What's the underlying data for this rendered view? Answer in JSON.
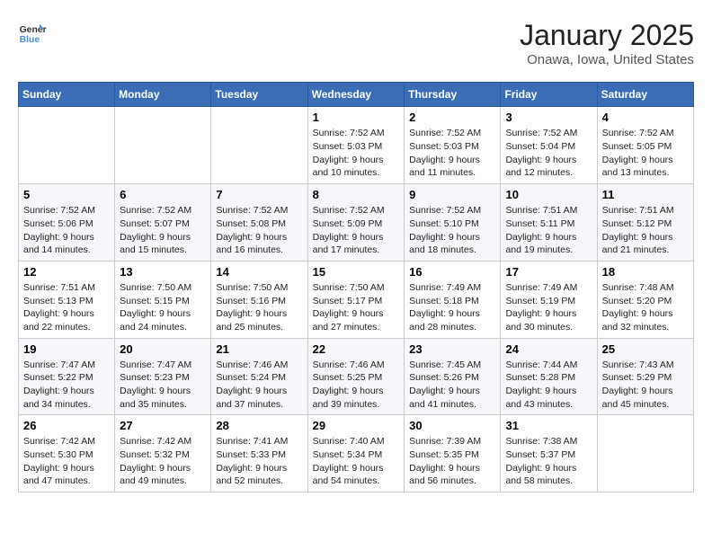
{
  "logo": {
    "line1": "General",
    "line2": "Blue"
  },
  "title": "January 2025",
  "location": "Onawa, Iowa, United States",
  "weekdays": [
    "Sunday",
    "Monday",
    "Tuesday",
    "Wednesday",
    "Thursday",
    "Friday",
    "Saturday"
  ],
  "weeks": [
    [
      {
        "day": "",
        "info": ""
      },
      {
        "day": "",
        "info": ""
      },
      {
        "day": "",
        "info": ""
      },
      {
        "day": "1",
        "info": "Sunrise: 7:52 AM\nSunset: 5:03 PM\nDaylight: 9 hours\nand 10 minutes."
      },
      {
        "day": "2",
        "info": "Sunrise: 7:52 AM\nSunset: 5:03 PM\nDaylight: 9 hours\nand 11 minutes."
      },
      {
        "day": "3",
        "info": "Sunrise: 7:52 AM\nSunset: 5:04 PM\nDaylight: 9 hours\nand 12 minutes."
      },
      {
        "day": "4",
        "info": "Sunrise: 7:52 AM\nSunset: 5:05 PM\nDaylight: 9 hours\nand 13 minutes."
      }
    ],
    [
      {
        "day": "5",
        "info": "Sunrise: 7:52 AM\nSunset: 5:06 PM\nDaylight: 9 hours\nand 14 minutes."
      },
      {
        "day": "6",
        "info": "Sunrise: 7:52 AM\nSunset: 5:07 PM\nDaylight: 9 hours\nand 15 minutes."
      },
      {
        "day": "7",
        "info": "Sunrise: 7:52 AM\nSunset: 5:08 PM\nDaylight: 9 hours\nand 16 minutes."
      },
      {
        "day": "8",
        "info": "Sunrise: 7:52 AM\nSunset: 5:09 PM\nDaylight: 9 hours\nand 17 minutes."
      },
      {
        "day": "9",
        "info": "Sunrise: 7:52 AM\nSunset: 5:10 PM\nDaylight: 9 hours\nand 18 minutes."
      },
      {
        "day": "10",
        "info": "Sunrise: 7:51 AM\nSunset: 5:11 PM\nDaylight: 9 hours\nand 19 minutes."
      },
      {
        "day": "11",
        "info": "Sunrise: 7:51 AM\nSunset: 5:12 PM\nDaylight: 9 hours\nand 21 minutes."
      }
    ],
    [
      {
        "day": "12",
        "info": "Sunrise: 7:51 AM\nSunset: 5:13 PM\nDaylight: 9 hours\nand 22 minutes."
      },
      {
        "day": "13",
        "info": "Sunrise: 7:50 AM\nSunset: 5:15 PM\nDaylight: 9 hours\nand 24 minutes."
      },
      {
        "day": "14",
        "info": "Sunrise: 7:50 AM\nSunset: 5:16 PM\nDaylight: 9 hours\nand 25 minutes."
      },
      {
        "day": "15",
        "info": "Sunrise: 7:50 AM\nSunset: 5:17 PM\nDaylight: 9 hours\nand 27 minutes."
      },
      {
        "day": "16",
        "info": "Sunrise: 7:49 AM\nSunset: 5:18 PM\nDaylight: 9 hours\nand 28 minutes."
      },
      {
        "day": "17",
        "info": "Sunrise: 7:49 AM\nSunset: 5:19 PM\nDaylight: 9 hours\nand 30 minutes."
      },
      {
        "day": "18",
        "info": "Sunrise: 7:48 AM\nSunset: 5:20 PM\nDaylight: 9 hours\nand 32 minutes."
      }
    ],
    [
      {
        "day": "19",
        "info": "Sunrise: 7:47 AM\nSunset: 5:22 PM\nDaylight: 9 hours\nand 34 minutes."
      },
      {
        "day": "20",
        "info": "Sunrise: 7:47 AM\nSunset: 5:23 PM\nDaylight: 9 hours\nand 35 minutes."
      },
      {
        "day": "21",
        "info": "Sunrise: 7:46 AM\nSunset: 5:24 PM\nDaylight: 9 hours\nand 37 minutes."
      },
      {
        "day": "22",
        "info": "Sunrise: 7:46 AM\nSunset: 5:25 PM\nDaylight: 9 hours\nand 39 minutes."
      },
      {
        "day": "23",
        "info": "Sunrise: 7:45 AM\nSunset: 5:26 PM\nDaylight: 9 hours\nand 41 minutes."
      },
      {
        "day": "24",
        "info": "Sunrise: 7:44 AM\nSunset: 5:28 PM\nDaylight: 9 hours\nand 43 minutes."
      },
      {
        "day": "25",
        "info": "Sunrise: 7:43 AM\nSunset: 5:29 PM\nDaylight: 9 hours\nand 45 minutes."
      }
    ],
    [
      {
        "day": "26",
        "info": "Sunrise: 7:42 AM\nSunset: 5:30 PM\nDaylight: 9 hours\nand 47 minutes."
      },
      {
        "day": "27",
        "info": "Sunrise: 7:42 AM\nSunset: 5:32 PM\nDaylight: 9 hours\nand 49 minutes."
      },
      {
        "day": "28",
        "info": "Sunrise: 7:41 AM\nSunset: 5:33 PM\nDaylight: 9 hours\nand 52 minutes."
      },
      {
        "day": "29",
        "info": "Sunrise: 7:40 AM\nSunset: 5:34 PM\nDaylight: 9 hours\nand 54 minutes."
      },
      {
        "day": "30",
        "info": "Sunrise: 7:39 AM\nSunset: 5:35 PM\nDaylight: 9 hours\nand 56 minutes."
      },
      {
        "day": "31",
        "info": "Sunrise: 7:38 AM\nSunset: 5:37 PM\nDaylight: 9 hours\nand 58 minutes."
      },
      {
        "day": "",
        "info": ""
      }
    ]
  ]
}
